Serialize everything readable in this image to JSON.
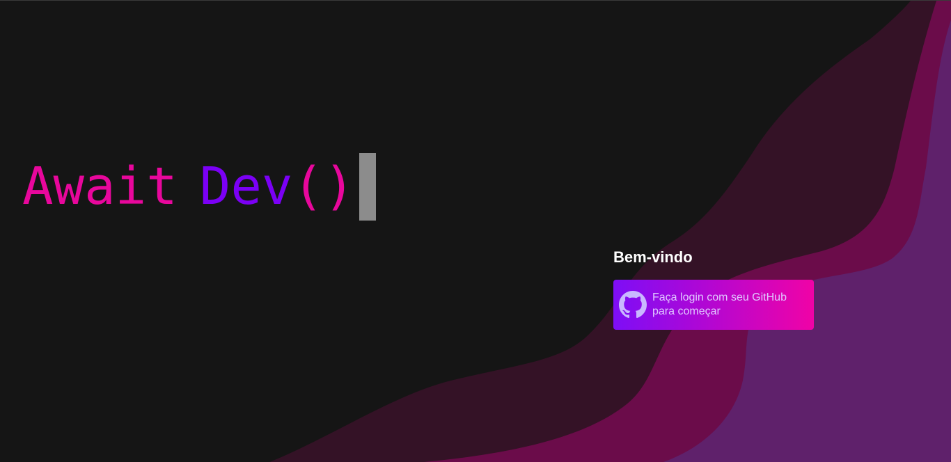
{
  "logo": {
    "await": "Await",
    "dev": "Dev",
    "parens": "()"
  },
  "welcome": {
    "title": "Bem-vindo"
  },
  "login": {
    "label": "Faça login com seu GitHub para começar",
    "icon": "github-icon"
  },
  "colors": {
    "background": "#151515",
    "pink": "#e8079c",
    "purple": "#7b00f5",
    "wave_dark": "#341226",
    "wave_mid": "#6b0c4a",
    "wave_light": "#5f216b"
  }
}
